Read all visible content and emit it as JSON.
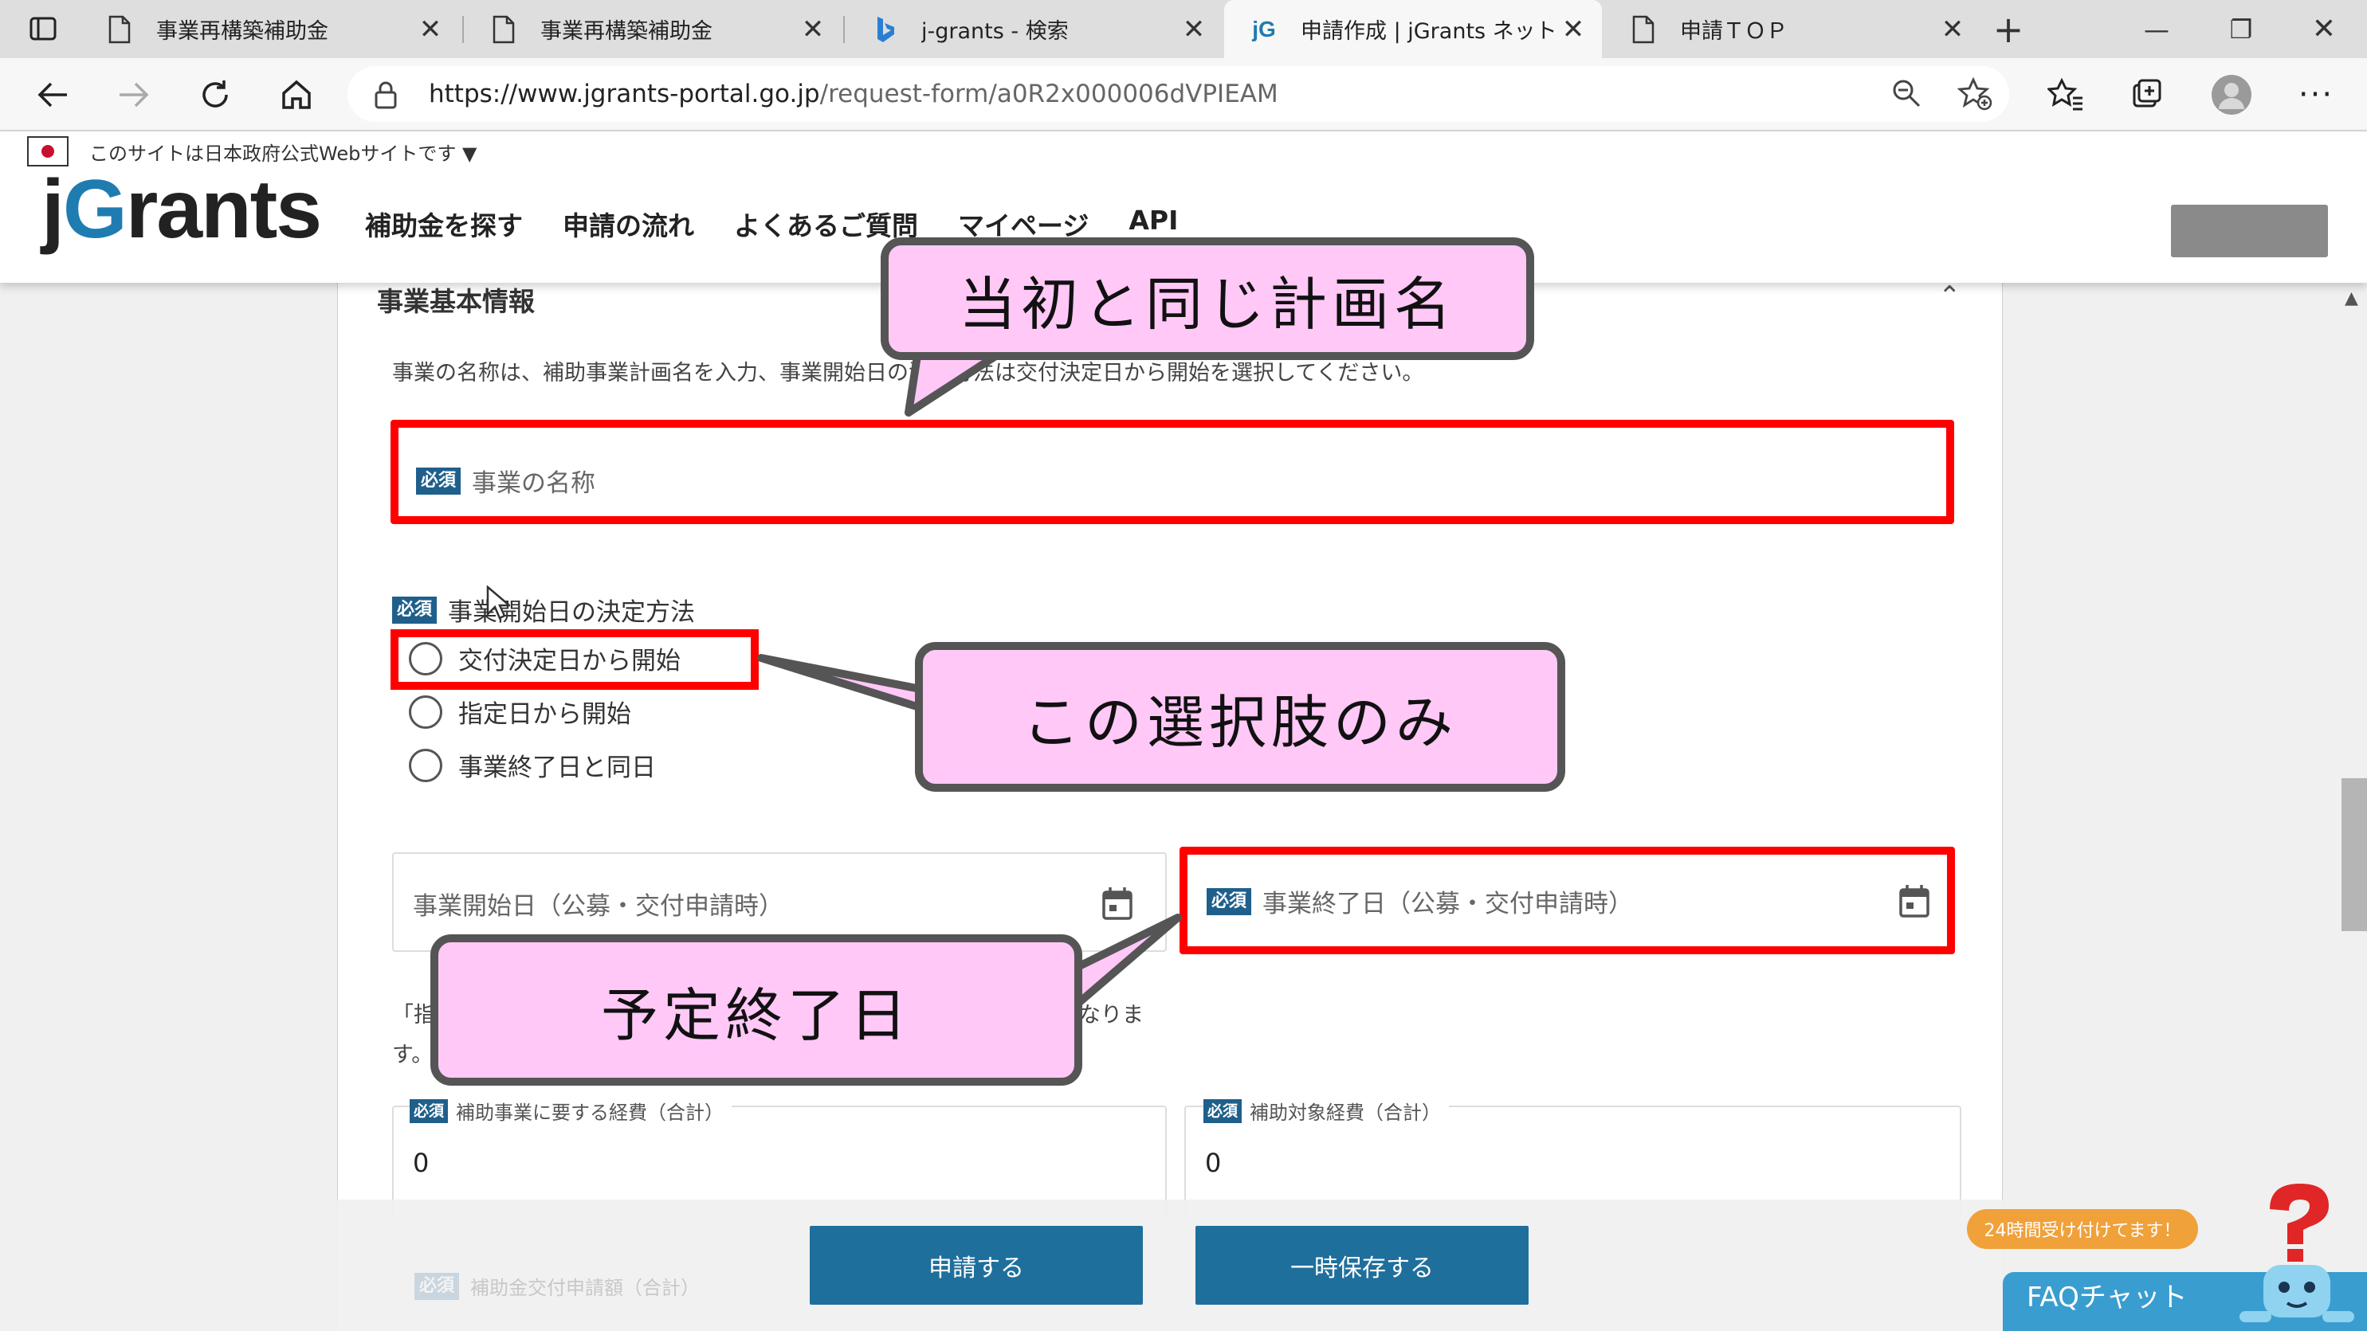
{
  "browser": {
    "tabs": [
      {
        "title": "事業再構築補助金",
        "icon": "page-icon"
      },
      {
        "title": "事業再構築補助金",
        "icon": "page-icon"
      },
      {
        "title": "j-grants - 検索",
        "icon": "bing-icon"
      },
      {
        "title": "申請作成 | jGrants ネットで",
        "icon": "jgrants-icon"
      },
      {
        "title": "申請ＴＯＰ",
        "icon": "page-icon"
      }
    ],
    "active_tab": 3,
    "url_domain": "https://www.jgrants-portal.go.jp",
    "url_path": "/request-form/a0R2x000006dVPIEAM"
  },
  "site": {
    "gov_notice": "このサイトは日本政府公式Webサイトです ▼",
    "logo_j": "j",
    "logo_g": "G",
    "logo_rest": "rants",
    "nav": [
      "補助金を探す",
      "申請の流れ",
      "よくあるご質問",
      "マイページ",
      "API"
    ]
  },
  "form": {
    "section_title": "事業基本情報",
    "description": "事業の名称は、補助事業計画名を入力、事業開始日の決定方法は交付決定日から開始を選択してください。",
    "required_badge": "必須",
    "business_name_placeholder": "事業の名称",
    "start_method_label": "事業開始日の決定方法",
    "start_method_options": [
      "交付決定日から開始",
      "指定日から開始",
      "事業終了日と同日"
    ],
    "start_date_placeholder": "事業開始日（公募・交付申請時）",
    "end_date_placeholder": "事業終了日（公募・交付申請時）",
    "note_head": "「指",
    "note_tail": "なりま",
    "note_line2": "す。",
    "total_cost_label": "補助事業に要する経費（合計）",
    "total_cost_value": "0",
    "eligible_cost_label": "補助対象経費（合計）",
    "eligible_cost_value": "0",
    "grant_amount_label": "補助金交付申請額（合計）"
  },
  "actions": {
    "submit": "申請する",
    "save_draft": "一時保存する"
  },
  "chat": {
    "pill": "24時間受け付けてます！",
    "label": "FAQチャット"
  },
  "annotations": {
    "callout_name": "当初と同じ計画名",
    "callout_option": "この選択肢のみ",
    "callout_end": "予定終了日"
  },
  "colors": {
    "highlight_red": "#ff0000",
    "callout_fill": "#ffc8f7",
    "callout_border": "#555555",
    "button_blue": "#1f6f9c",
    "required_badge": "#1f5f8b",
    "chat_orange": "#f0a13a",
    "chat_blue": "#3a9dd0"
  }
}
